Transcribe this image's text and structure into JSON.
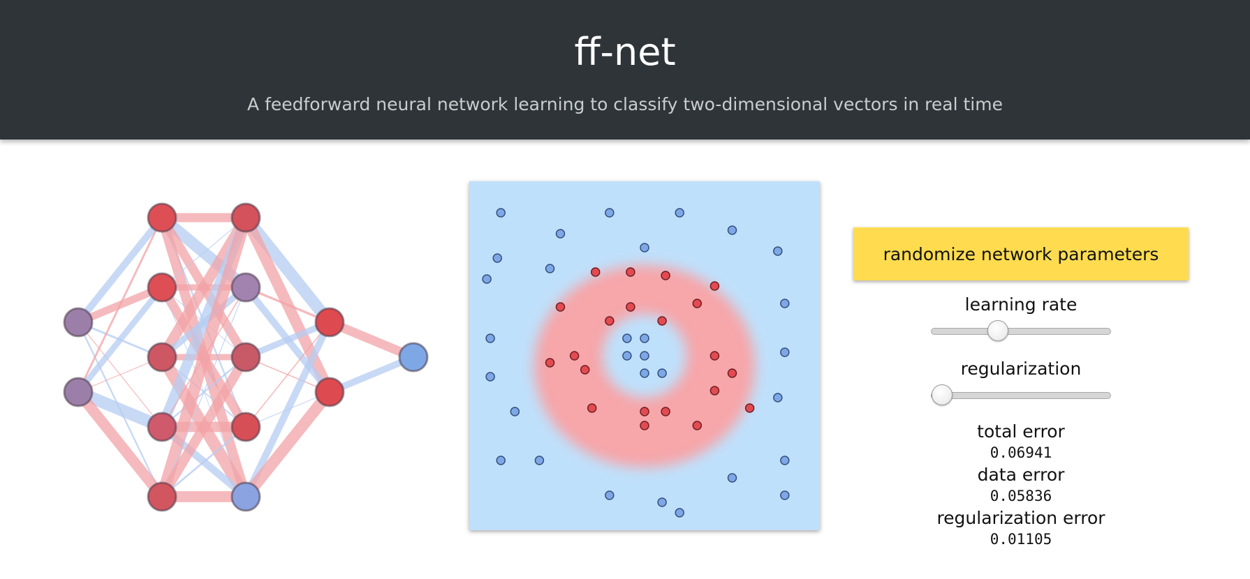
{
  "header": {
    "title": "ff-net",
    "subtitle": "A feedforward neural network learning to classify two-dimensional vectors in real time"
  },
  "colors": {
    "header_bg": "#2e3438",
    "button_bg": "#ffdc4f",
    "plot_background": "#bfe0fb",
    "plot_ring": "#f7a6a9",
    "positive_class": "#e34b51",
    "negative_class": "#7ea7e6",
    "neutral_node": "#9c7fa8"
  },
  "network": {
    "layers": [
      {
        "name": "input",
        "nodes": [
          {
            "color": "#9c7fa8"
          },
          {
            "color": "#9c7fa8"
          }
        ]
      },
      {
        "name": "hidden-1",
        "nodes": [
          {
            "color": "#dd4f55"
          },
          {
            "color": "#dd4f55"
          },
          {
            "color": "#ce5764"
          },
          {
            "color": "#cf5a6c"
          },
          {
            "color": "#d2565f"
          }
        ]
      },
      {
        "name": "hidden-2",
        "nodes": [
          {
            "color": "#d3525b"
          },
          {
            "color": "#a283b0"
          },
          {
            "color": "#c85a68"
          },
          {
            "color": "#d64f57"
          },
          {
            "color": "#8ba3e0"
          }
        ]
      },
      {
        "name": "hidden-3",
        "nodes": [
          {
            "color": "#dd4a50"
          },
          {
            "color": "#dd4a50"
          }
        ]
      },
      {
        "name": "output",
        "nodes": [
          {
            "color": "#7ea7e6"
          }
        ]
      }
    ],
    "connection_colors": {
      "positive": "#f2a3a7",
      "negative": "#b5ccf2"
    }
  },
  "data_points": {
    "negative": [
      [
        -0.82,
        -0.82
      ],
      [
        -0.2,
        -0.82
      ],
      [
        0.2,
        -0.82
      ],
      [
        0.5,
        -0.72
      ],
      [
        -0.48,
        -0.7
      ],
      [
        0.0,
        -0.62
      ],
      [
        -0.84,
        -0.56
      ],
      [
        -0.54,
        -0.5
      ],
      [
        -0.9,
        -0.44
      ],
      [
        0.76,
        -0.6
      ],
      [
        0.8,
        -0.3
      ],
      [
        0.8,
        -0.02
      ],
      [
        0.76,
        0.24
      ],
      [
        -0.88,
        -0.1
      ],
      [
        -0.88,
        0.12
      ],
      [
        -0.74,
        0.32
      ],
      [
        -0.82,
        0.6
      ],
      [
        -0.6,
        0.6
      ],
      [
        -0.2,
        0.8
      ],
      [
        0.1,
        0.84
      ],
      [
        0.2,
        0.9
      ],
      [
        0.5,
        0.7
      ],
      [
        0.8,
        0.6
      ],
      [
        0.8,
        0.8
      ],
      [
        -0.1,
        -0.1
      ],
      [
        0.0,
        -0.1
      ],
      [
        -0.1,
        0.0
      ],
      [
        0.0,
        0.0
      ],
      [
        0.0,
        0.1
      ],
      [
        0.1,
        0.1
      ]
    ],
    "positive": [
      [
        -0.28,
        -0.48
      ],
      [
        -0.08,
        -0.48
      ],
      [
        0.12,
        -0.46
      ],
      [
        0.4,
        -0.4
      ],
      [
        0.3,
        -0.3
      ],
      [
        -0.48,
        -0.28
      ],
      [
        -0.08,
        -0.28
      ],
      [
        -0.2,
        -0.2
      ],
      [
        0.1,
        -0.2
      ],
      [
        -0.4,
        0.0
      ],
      [
        0.4,
        0.0
      ],
      [
        -0.54,
        0.04
      ],
      [
        -0.34,
        0.08
      ],
      [
        0.5,
        0.1
      ],
      [
        0.4,
        0.2
      ],
      [
        -0.3,
        0.3
      ],
      [
        0.6,
        0.3
      ],
      [
        0.0,
        0.32
      ],
      [
        0.12,
        0.32
      ],
      [
        0.0,
        0.4
      ],
      [
        0.3,
        0.4
      ]
    ]
  },
  "controls": {
    "randomize_label": "randomize network parameters",
    "learning_rate_label": "learning rate",
    "learning_rate_value": 0.37,
    "regularization_label": "regularization",
    "regularization_value": 0.06
  },
  "errors": {
    "total_label": "total error",
    "total_value": "0.06941",
    "data_label": "data error",
    "data_value": "0.05836",
    "reg_label": "regularization error",
    "reg_value": "0.01105"
  }
}
